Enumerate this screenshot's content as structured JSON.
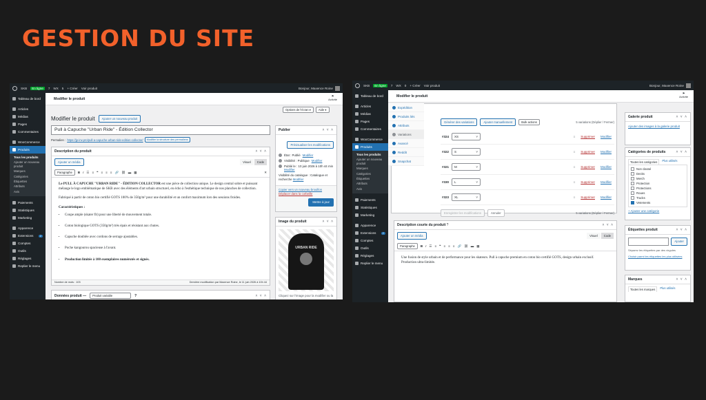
{
  "title": "GESTION DU SITE",
  "admin_bar": {
    "site": "SKB",
    "status": "En ligne",
    "comments": "7",
    "woo": "WX",
    "new_count_1": "5",
    "new_count_2": "0",
    "new": "+ Créer",
    "view": "Voir produit",
    "greeting": "Bonjour, Maxence Roine"
  },
  "menu": {
    "items_top": [
      "Tableau de bord",
      "Articles",
      "Médias",
      "Pages",
      "Commentaires"
    ],
    "woocommerce": "WooCommerce",
    "products": "Produits",
    "submenu_1": [
      "Tous les produits",
      "Ajouter un nouveau produit",
      "Marques",
      "Catégories",
      "Étiquettes",
      "Attributs",
      "Avis"
    ],
    "submenu_2": [
      "Tous les produits",
      "Ajouter un nouveau produit",
      "Marques",
      "Catégories",
      "Étiquettes",
      "Attributs",
      "Avis"
    ],
    "items_bottom": [
      "Paiements",
      "Statistiques",
      "Marketing"
    ],
    "items_bottom2": [
      "Apparence",
      "Extensions",
      "Comptes",
      "Outils",
      "Réglages",
      "Replier le menu"
    ],
    "ext_badge": "2"
  },
  "screen1": {
    "header": "Modifier le produit",
    "activity": "Activité",
    "screen_options": "Options de l'écran ▾",
    "help": "Aide ▾",
    "page_title": "Modifier le produit",
    "add_new": "Ajouter un nouveau produit",
    "product_title": "Pull à Capuche \"Urban Ride\" - Édition Collector",
    "permalink_label": "Permalien :",
    "permalink_url": "https://jp-inv.pro/pull-a-capuche-urban-ride-edition-collector/",
    "permalink_btn": "Modifier la structure des permaliens",
    "desc_box": "Description du produit",
    "add_media": "Ajouter un média",
    "visual": "Visuel",
    "code": "Code",
    "paragraph": "Paragraphe",
    "desc_p1_bold": "Le PULL À CAPUCHE \"URBAN RIDE\" - ÉDITION COLLECTOR",
    "desc_p1": " est une pièce de collection unique. Le design central sobre et puissant mélange le logo emblématique de SKB avec des éléments d'art urbain structurel, en écho à l'esthétique technique de nos planches de collection.",
    "desc_p2": "Fabriqué à partir de coton bio certifié GOTS 100% de 350g/m² pour une durabilité et un confort maximum lors des sessions froides.",
    "char_title": "Caractéristiques :",
    "features": [
      "Coupe ample (skater fit) pour une liberté de mouvement totale.",
      "Coton biologique GOTS (350g/m²) très épais et résistant aux chutes.",
      "Capuche doublée avec cordons de serrage ajustables.",
      "Poche kangourou spacieuse à l'avant."
    ],
    "feature_bold": "Production limitée à 100 exemplaires numérotés et signés.",
    "word_count": "Nombre de mots : 103",
    "last_modified": "Dernière modification par Maxence Roine, le 11 juin 2026 à 10h 44",
    "data_box": "Données produit —",
    "product_type": "Produit variable",
    "publish": {
      "title": "Publier",
      "preview": "Prévisualiser les modifications",
      "status_label": "État : Publié",
      "status_edit": "Modifier",
      "visibility": "Visibilité : Publique",
      "visibility_edit": "Modifier",
      "published": "Publié le : 10 juin 2026 à 10h 44 min",
      "published_edit": "Modifier",
      "catalog": "Visibilité du catalogue : Catalogue et recherche",
      "catalog_edit": "Modifier",
      "copy_draft": "Copier vers un nouveau brouillon",
      "trash": "Déplacer dans la corbeille",
      "update": "Mettre à jour"
    },
    "image_box": "Image du produit",
    "image_text": "URBAN RIDE",
    "image_hint": "Cliquez sur l'image pour la modifier ou la"
  },
  "screen2": {
    "header": "Modifier le produit",
    "activity": "Activité",
    "tabs": [
      "Expédition",
      "Produits liés",
      "Attributs",
      "Variations",
      "Avancé",
      "Reddit",
      "Snapchat"
    ],
    "gen_btn": "Générer des variations",
    "add_manual": "Ajouter manuellement",
    "bulk": "Bulk actions",
    "var_count": "5 variations (Déplier / Fermer)",
    "variations": [
      {
        "id": "#324",
        "size": "XS"
      },
      {
        "id": "#322",
        "size": "S"
      },
      {
        "id": "#321",
        "size": "M"
      },
      {
        "id": "#330",
        "size": "L"
      },
      {
        "id": "#323",
        "size": "XL"
      }
    ],
    "remove": "Supprimer",
    "edit": "Modifier",
    "save_btn": "Enregistrer les modifications",
    "cancel_btn": "Annuler",
    "short_desc_box": "Description courte du produit",
    "add_media": "Ajouter un média",
    "visual": "Visuel",
    "code": "Code",
    "paragraph": "Paragraphe",
    "short_desc": "Une fusion de style urbain et de performance pour les skateurs. Pull à capuche premium en coton bio certifié GOTS, design urbain exclusif. Production ultra-limitée.",
    "gallery": {
      "title": "Galerie produit",
      "link": "Ajouter des images à la galerie produit"
    },
    "categories": {
      "title": "Catégories de produits",
      "tab_all": "Toutes les catégories",
      "tab_used": "Plus utilisés",
      "items": [
        "Non classé",
        "Decks",
        "Merch",
        "Protection",
        "Protections",
        "Roues",
        "Trucks",
        "Vetements"
      ],
      "add": "+ Ajouter une catégorie"
    },
    "tags": {
      "title": "Étiquettes produit",
      "add": "Ajouter",
      "hint": "Séparez les étiquettes par des virgules",
      "choose": "Choisir parmi les étiquettes les plus utilisées"
    },
    "brands": {
      "title": "Marques",
      "tab_all": "Toutes les marques",
      "tab_used": "Plus utilisés"
    }
  }
}
